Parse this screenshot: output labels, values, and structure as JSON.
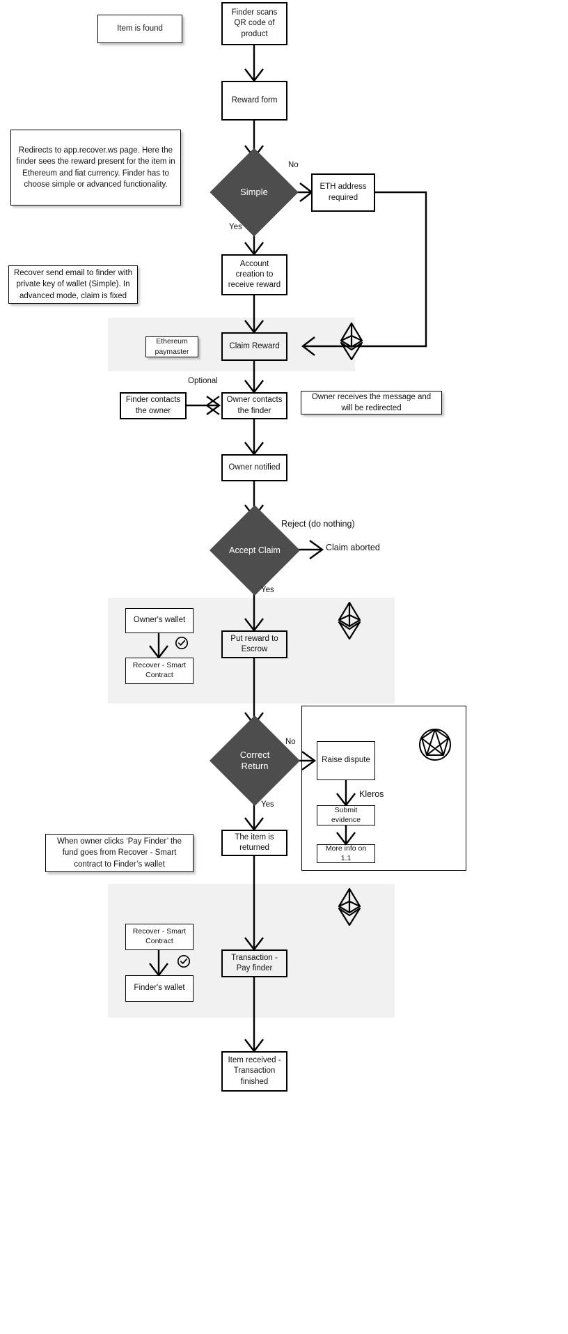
{
  "title": "Recover lost item reward claim flowchart",
  "colors": {
    "diamond_fill": "#4d4d4d",
    "diamond_text": "#ffffff",
    "band_fill": "#f1f1f1",
    "stroke": "#000000",
    "box_fill": "#ffffff"
  },
  "nodes": {
    "item_found": "Item is found",
    "finder_scans": "Finder scans\nQR code of\nproduct",
    "reward_form": "Reward form",
    "simple": "Simple",
    "eth_address": "ETH address\nrequired",
    "account_creation": "Account\ncreation to\nreceive reward",
    "ethereum_paymaster": "Ethereum\npaymaster",
    "claim_reward": "Claim Reward",
    "finder_contacts": "Finder contacts\nthe owner",
    "owner_contacts": "Owner contacts\nthe finder",
    "owner_notified": "Owner notified",
    "accept_claim": "Accept Claim",
    "claim_aborted": "Claim aborted",
    "owners_wallet": "Owner's wallet",
    "recover_smart_contract_1": "Recover - Smart\nContract",
    "put_reward_escrow": "Put reward to\nEscrow",
    "correct_return": "Correct\nReturn",
    "raise_dispute": "Raise dispute",
    "submit_evidence": "Submit evidence",
    "more_info": "More info on 1.1",
    "item_returned": "The item is\nreturned",
    "recover_smart_contract_2": "Recover - Smart\nContract",
    "finders_wallet": "Finder's wallet",
    "transaction_pay_finder": "Transaction -\nPay finder",
    "item_received": "Item received -\nTransaction\nfinished"
  },
  "notes": {
    "redirects": "Redirects to app.recover.ws page. Here the finder sees the reward present for the item in Ethereum and fiat currency. Finder has to choose simple or advanced functionality.",
    "recover_email": "Recover send email to finder with private key of wallet (Simple). In advanced mode, claim is fixed",
    "owner_receives": "Owner receives the message and will be redirected",
    "pay_finder": "When owner clicks ‘Pay Finder’ the fund goes from Recover - Smart contract to Finder’s wallet"
  },
  "edge_labels": {
    "simple_no": "No",
    "simple_yes": "Yes",
    "optional": "Optional",
    "reject": "Reject (do nothing)",
    "accept_yes": "Yes",
    "correct_no": "No",
    "correct_yes": "Yes",
    "kleros": "Kleros"
  },
  "icons": {
    "ethereum_1": "ethereum-logo-icon",
    "ethereum_2": "ethereum-logo-icon",
    "ethereum_3": "ethereum-logo-icon",
    "kleros": "kleros-logo-icon",
    "check_1": "check-circle-icon",
    "check_2": "check-circle-icon"
  }
}
